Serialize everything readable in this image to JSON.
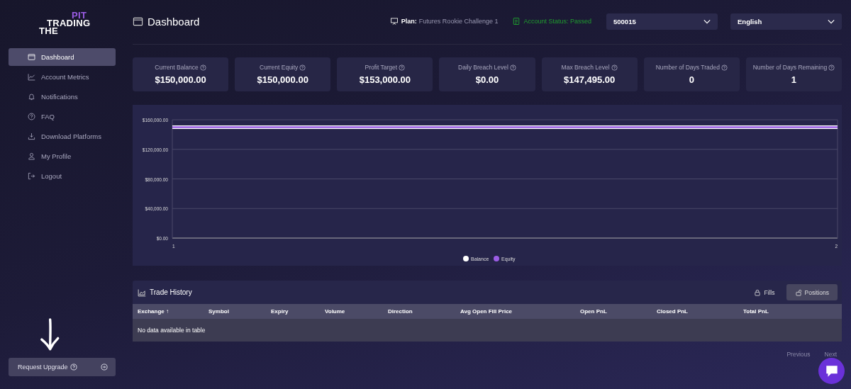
{
  "brand": {
    "lines": [
      "PIT",
      "TRADING",
      "THE"
    ]
  },
  "sidebar": {
    "items": [
      {
        "label": "Dashboard",
        "selected": true
      },
      {
        "label": "Account Metrics",
        "selected": false
      },
      {
        "label": "Notifications",
        "selected": false
      },
      {
        "label": "FAQ",
        "selected": false
      },
      {
        "label": "Download Platforms",
        "selected": false
      },
      {
        "label": "My Profile",
        "selected": false
      },
      {
        "label": "Logout",
        "selected": false
      }
    ],
    "upgrade_button": {
      "label": "Request Upgrade"
    }
  },
  "header": {
    "title": "Dashboard",
    "plan_label": "Plan:",
    "plan_value": "Futures Rookie Challenge 1",
    "account_status": "Account Status: Passed",
    "account_select": "500015",
    "language_select": "English"
  },
  "stats": [
    {
      "label": "Current Balance",
      "value": "$150,000.00"
    },
    {
      "label": "Current Equity",
      "value": "$150,000.00"
    },
    {
      "label": "Profit Target",
      "value": "$153,000.00"
    },
    {
      "label": "Daily Breach Level",
      "value": "$0.00"
    },
    {
      "label": "Max Breach Level",
      "value": "$147,495.00"
    },
    {
      "label": "Number of Days Traded",
      "value": "0"
    },
    {
      "label": "Number of Days Remaining",
      "value": "1"
    }
  ],
  "chart": {
    "chart_data": {
      "type": "line",
      "x": [
        1,
        2
      ],
      "series": [
        {
          "name": "Balance",
          "color": "#ffffff",
          "values": [
            150000,
            150000
          ]
        },
        {
          "name": "Equity",
          "color": "#9b5de5",
          "values": [
            150000,
            150000
          ]
        }
      ],
      "grid": true,
      "legend": "bottom",
      "xlim": [
        1,
        2
      ],
      "ylim": [
        0,
        160000
      ],
      "xticks": [
        1,
        2
      ],
      "yticks": [
        {
          "value": 0,
          "label": "$0.00"
        },
        {
          "value": 40000,
          "label": "$40,000.00"
        },
        {
          "value": 80000,
          "label": "$80,000.00"
        },
        {
          "value": 120000,
          "label": "$120,000.00"
        },
        {
          "value": 160000,
          "label": "$160,000.00"
        }
      ]
    }
  },
  "trade_history": {
    "title": "Trade History",
    "tabs": [
      {
        "label": "Fills",
        "selected": false
      },
      {
        "label": "Positions",
        "selected": true
      }
    ],
    "columns": [
      "Exchange ↑",
      "Symbol",
      "Expiry",
      "Volume",
      "Direction",
      "Avg Open Fill Price",
      "Open PnL",
      "Closed PnL",
      "Total PnL"
    ],
    "empty_message": "No data available in table"
  },
  "pagination": {
    "previous": "Previous",
    "next": "Next"
  }
}
